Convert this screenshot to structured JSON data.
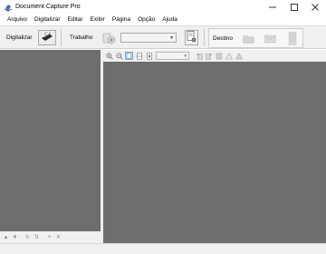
{
  "window": {
    "title": "Document Capture Pro",
    "controls": [
      "minimize",
      "maximize",
      "close"
    ]
  },
  "menu": {
    "items": [
      "Arquivo",
      "Digitalizar",
      "Editar",
      "Exibir",
      "Página",
      "Opção",
      "Ajuda"
    ]
  },
  "toolbar": {
    "scan_label": "Digitalizar",
    "job_label": "Trabalho",
    "job_selected": "",
    "destination_label": "Destino",
    "destinations": [
      "folder-icon",
      "email-icon",
      "printer-icon"
    ]
  },
  "left_panel": {
    "thumbnails": [],
    "tools": [
      "move-up-icon",
      "move-down-icon",
      "rotate-icon",
      "sort-icon",
      "add-icon",
      "delete-icon"
    ]
  },
  "view_toolbar": {
    "zoom_value": "",
    "tools": [
      "zoom-in-icon",
      "zoom-out-icon",
      "fit-page-icon",
      "fit-width-icon",
      "actual-size-icon",
      "rotate-left-icon",
      "rotate-right-icon",
      "flip-icon",
      "deskew-left-icon",
      "deskew-right-icon"
    ]
  },
  "colors": {
    "panel_bg": "#6e6e6e",
    "chrome_bg": "#f0f0f0",
    "window_bg": "#ffffff",
    "active_tool": "#dceaf8"
  }
}
